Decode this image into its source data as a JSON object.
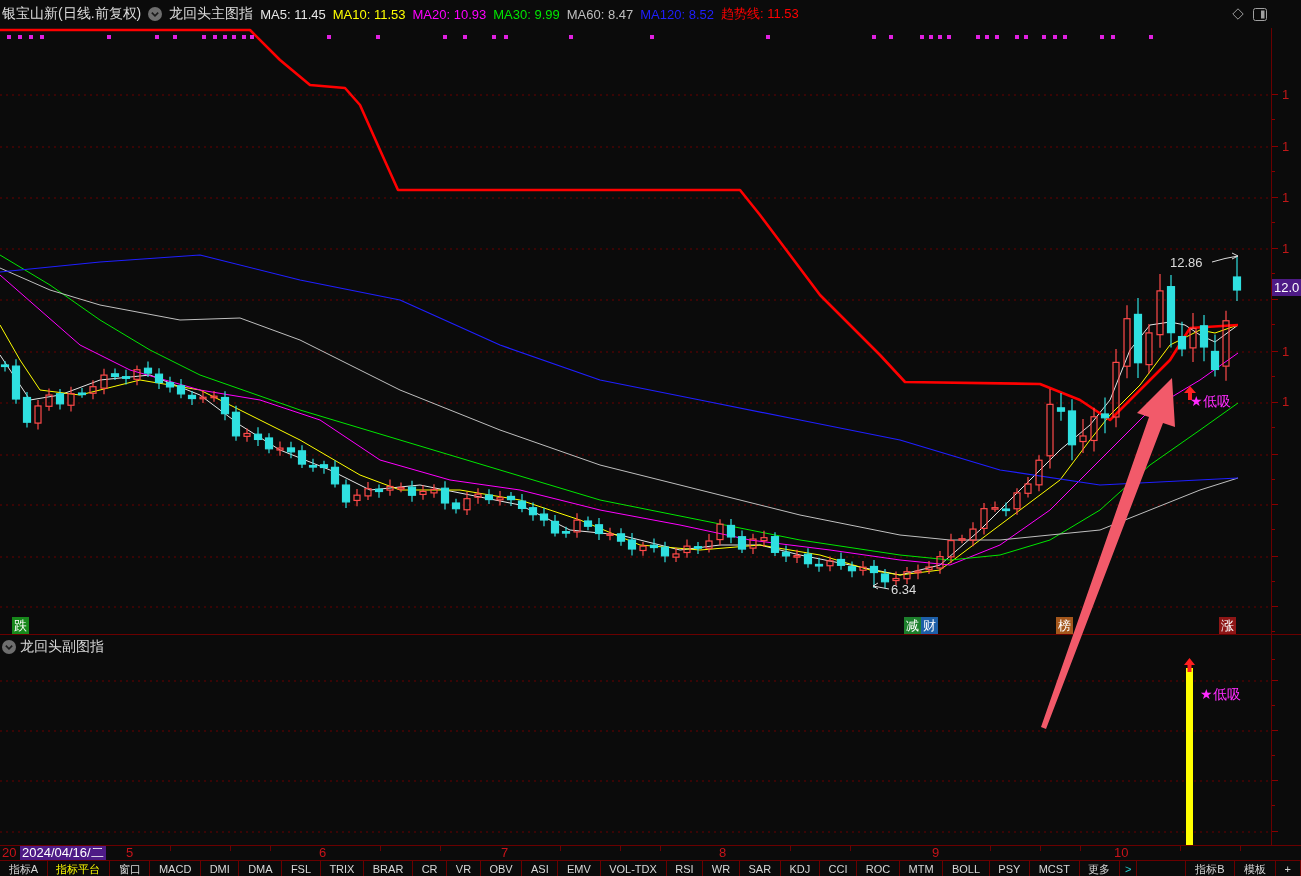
{
  "header": {
    "security": "银宝山新(日线.前复权)",
    "indicator": "龙回头主图指",
    "readouts": [
      {
        "text": "MA5: 11.45",
        "color": "#e6e6e6"
      },
      {
        "text": "MA10: 11.53",
        "color": "#ffff00"
      },
      {
        "text": "MA20: 10.93",
        "color": "#ff00ff"
      },
      {
        "text": "MA30: 9.99",
        "color": "#00e600"
      },
      {
        "text": "MA60: 8.47",
        "color": "#bfbfbf"
      },
      {
        "text": "MA120: 8.52",
        "color": "#1f1fff"
      },
      {
        "text": "趋势线: 11.53",
        "color": "#ff0000"
      }
    ]
  },
  "main_chart": {
    "axis_labels": [
      "1",
      "1",
      "1",
      "1",
      "1",
      "1"
    ],
    "price_tag": "12.0",
    "high_label": "12.86",
    "low_label": "6.34",
    "signal_label": "★低吸",
    "event_markers": [
      {
        "text": "跌",
        "color": "#17881b"
      },
      {
        "text": "减",
        "color": "#1c7f2c"
      },
      {
        "text": "财",
        "color": "#1d5fa8"
      },
      {
        "text": "榜",
        "color": "#a4571c"
      },
      {
        "text": "涨",
        "color": "#8e1616"
      }
    ]
  },
  "sub_chart": {
    "title": "龙回头副图指",
    "signal_label": "★低吸"
  },
  "date_axis": {
    "labels": [
      "20",
      "5",
      "6",
      "7",
      "8",
      "9",
      "10"
    ],
    "cursor_date": "2024/04/16/二"
  },
  "tabs": [
    {
      "label": "指标A",
      "selected": false
    },
    {
      "label": "指标平台",
      "selected": true
    },
    {
      "label": "窗口",
      "selected": false
    },
    {
      "label": "MACD",
      "selected": false
    },
    {
      "label": "DMI",
      "selected": false
    },
    {
      "label": "DMA",
      "selected": false
    },
    {
      "label": "FSL",
      "selected": false
    },
    {
      "label": "TRIX",
      "selected": false
    },
    {
      "label": "BRAR",
      "selected": false
    },
    {
      "label": "CR",
      "selected": false
    },
    {
      "label": "VR",
      "selected": false
    },
    {
      "label": "OBV",
      "selected": false
    },
    {
      "label": "ASI",
      "selected": false
    },
    {
      "label": "EMV",
      "selected": false
    },
    {
      "label": "VOL-TDX",
      "selected": false
    },
    {
      "label": "RSI",
      "selected": false
    },
    {
      "label": "WR",
      "selected": false
    },
    {
      "label": "SAR",
      "selected": false
    },
    {
      "label": "KDJ",
      "selected": false
    },
    {
      "label": "CCI",
      "selected": false
    },
    {
      "label": "ROC",
      "selected": false
    },
    {
      "label": "MTM",
      "selected": false
    },
    {
      "label": "BOLL",
      "selected": false
    },
    {
      "label": "PSY",
      "selected": false
    },
    {
      "label": "MCST",
      "selected": false
    },
    {
      "label": "更多",
      "selected": false
    }
  ],
  "tab_scroll": ">",
  "right_tabs": [
    "指标B",
    "模板",
    "+"
  ]
}
